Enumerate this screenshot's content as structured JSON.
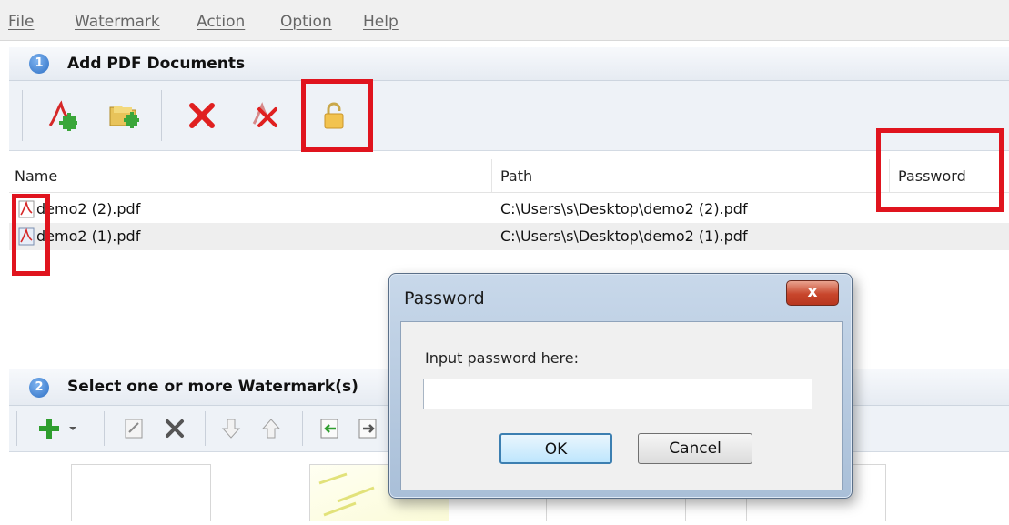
{
  "menu": {
    "items": [
      "File",
      "Watermark",
      "Action",
      "Option",
      "Help"
    ]
  },
  "section1": {
    "number": "1",
    "title": "Add PDF Documents"
  },
  "toolbar1": {
    "buttons": [
      "add-pdf-icon",
      "add-folder-icon",
      "remove-icon",
      "remove-all-icon",
      "lock-icon"
    ]
  },
  "file_list": {
    "columns": [
      "Name",
      "Path",
      "Password"
    ],
    "rows": [
      {
        "name": "demo2 (2).pdf",
        "path": "C:\\Users\\s\\Desktop\\demo2 (2).pdf",
        "password": ""
      },
      {
        "name": "demo2 (1).pdf",
        "path": "C:\\Users\\s\\Desktop\\demo2 (1).pdf",
        "password": ""
      }
    ]
  },
  "section2": {
    "number": "2",
    "title": "Select one or more Watermark(s)"
  },
  "toolbar2": {
    "buttons": [
      "add-icon",
      "dropdown-arrow-icon",
      "edit-icon",
      "delete-icon",
      "move-down-icon",
      "move-up-icon",
      "import-icon",
      "export-icon"
    ]
  },
  "dialog": {
    "title": "Password",
    "close_label": "x",
    "prompt": "Input password here:",
    "input_value": "",
    "ok_label": "OK",
    "cancel_label": "Cancel"
  },
  "colors": {
    "highlight": "#e0141e",
    "accent": "#2d6fc4"
  }
}
